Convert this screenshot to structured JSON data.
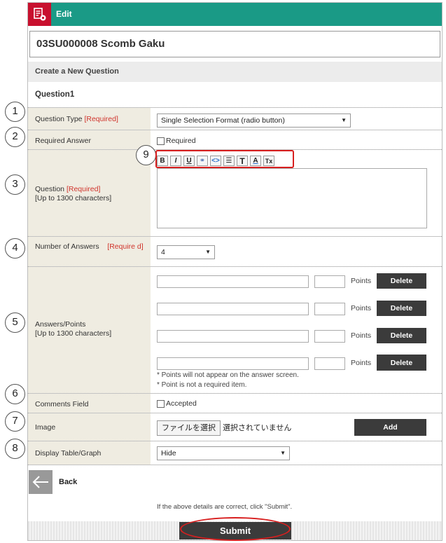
{
  "header": {
    "title": "Edit",
    "logo_icon": "report-edit-icon",
    "color": "#1a9a86",
    "logo_color": "#c8102e"
  },
  "course": {
    "name": "03SU000008 Scomb Gaku"
  },
  "section": {
    "title": "Create a New Question"
  },
  "question": {
    "number": "Question1"
  },
  "fields": {
    "type": {
      "label": "Question Type",
      "req": "[Required]",
      "value": "Single Selection Format (radio button)"
    },
    "required_answer": {
      "label": "Required Answer",
      "check_label": "Required"
    },
    "question": {
      "label": "Question",
      "req": "[Required]",
      "limit": "[Up to 1300 characters]"
    },
    "num_answers": {
      "label": "Number of Answers",
      "req": "[Require d]",
      "value": "4"
    },
    "answers": {
      "label": "Answers/Points",
      "limit": "[Up to 1300 characters]",
      "points_label": "Points",
      "delete_label": "Delete",
      "notes": [
        "* Points will not appear on the answer screen.",
        "* Point is not a required item."
      ]
    },
    "comments": {
      "label": "Comments Field",
      "check_label": "Accepted"
    },
    "image": {
      "label": "Image",
      "file_button": "ファイルを選択",
      "file_status": "選択されていません",
      "add_label": "Add"
    },
    "display": {
      "label": "Display Table/Graph",
      "value": "Hide"
    }
  },
  "toolbar": {
    "items": [
      {
        "label": "B",
        "icon": "bold-icon"
      },
      {
        "label": "I",
        "icon": "italic-icon"
      },
      {
        "label": "U",
        "icon": "underline-icon"
      },
      {
        "label": "⚭",
        "icon": "link-icon"
      },
      {
        "label": "<>",
        "icon": "code-icon"
      },
      {
        "label": "☰",
        "icon": "list-icon"
      },
      {
        "label": "T",
        "icon": "font-size-icon"
      },
      {
        "label": "A",
        "icon": "font-color-icon"
      },
      {
        "label": "Tx",
        "icon": "clear-format-icon"
      }
    ]
  },
  "callouts": [
    "1",
    "2",
    "3",
    "4",
    "5",
    "6",
    "7",
    "8",
    "9"
  ],
  "footer": {
    "back_label": "Back",
    "confirm_text": "If the above details are correct, click \"Submit\".",
    "submit_label": "Submit"
  }
}
